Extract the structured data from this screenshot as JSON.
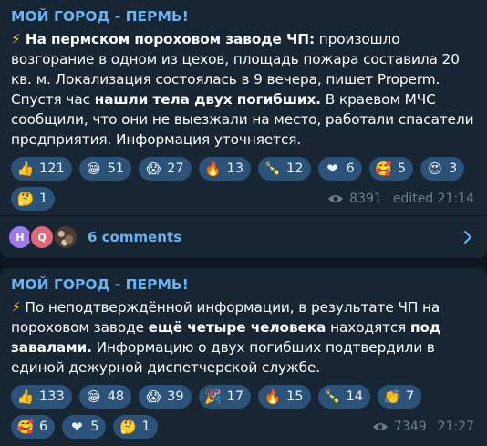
{
  "posts": [
    {
      "channel": "МОЙ ГОРОД - ПЕРМЬ!",
      "text": {
        "p1": "⚡",
        "p2": " На пермском пороховом заводе ЧП:",
        "p3": " произошло возгорание в одном из цехов, площадь пожара составила 20 кв. м. Локализация состоялась в 9 вечера, пишет Properm. Спустя час ",
        "p4": "нашли тела двух погибших.",
        "p5": " В краевом МЧС сообщили, что они не выезжали на место, работали спасатели предприятия. Информация уточняется."
      },
      "reactions": [
        {
          "emoji": "👍",
          "count": "121",
          "name": "thumbs-up"
        },
        {
          "emoji": "😁",
          "count": "51",
          "name": "grin"
        },
        {
          "emoji": "😱",
          "count": "27",
          "name": "scream"
        },
        {
          "emoji": "🔥",
          "count": "13",
          "name": "fire"
        },
        {
          "emoji": "🍾",
          "count": "12",
          "name": "champagne"
        },
        {
          "emoji": "❤",
          "count": "6",
          "name": "heart"
        },
        {
          "emoji": "🥰",
          "count": "5",
          "name": "smiling-hearts"
        },
        {
          "emoji": "😍",
          "count": "3",
          "name": "heart-eyes"
        },
        {
          "emoji": "🤔",
          "count": "1",
          "name": "thinking"
        }
      ],
      "views": "8391",
      "time": "edited 21:14",
      "comments_label": "6 comments",
      "avatars": [
        "H",
        "Q"
      ]
    },
    {
      "channel": "МОЙ ГОРОД - ПЕРМЬ!",
      "text": {
        "p1": "⚡",
        "p2": " По неподтверждённой информации, в результате ЧП на пороховом заводе ",
        "p3": "ещё четыре человека",
        "p4": " находятся ",
        "p5": "под завалами.",
        "p6": " Информацию о двух погибших подтвердили в единой дежурной диспетчерской службе."
      },
      "reactions": [
        {
          "emoji": "👍",
          "count": "133",
          "name": "thumbs-up"
        },
        {
          "emoji": "😁",
          "count": "48",
          "name": "grin"
        },
        {
          "emoji": "😱",
          "count": "39",
          "name": "scream"
        },
        {
          "emoji": "🎉",
          "count": "17",
          "name": "party-popper"
        },
        {
          "emoji": "🔥",
          "count": "15",
          "name": "fire"
        },
        {
          "emoji": "🍾",
          "count": "14",
          "name": "champagne"
        },
        {
          "emoji": "👏",
          "count": "7",
          "name": "clap"
        },
        {
          "emoji": "🥰",
          "count": "6",
          "name": "smiling-hearts"
        },
        {
          "emoji": "❤",
          "count": "5",
          "name": "heart"
        },
        {
          "emoji": "🤔",
          "count": "1",
          "name": "thinking"
        }
      ],
      "views": "7349",
      "time": "21:27"
    }
  ],
  "colors": {
    "background": "#0e1621",
    "bubble": "#182533",
    "accent": "#6ab3f3",
    "reaction_pill": "#2b5278",
    "meta": "#6d7f8f"
  }
}
